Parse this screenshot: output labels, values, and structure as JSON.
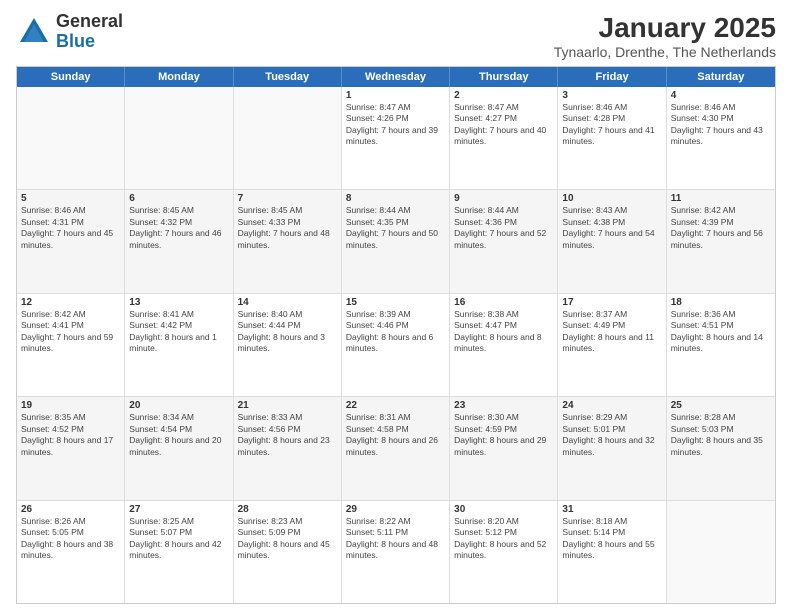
{
  "logo": {
    "general": "General",
    "blue": "Blue"
  },
  "header": {
    "month": "January 2025",
    "location": "Tynaarlo, Drenthe, The Netherlands"
  },
  "weekdays": [
    "Sunday",
    "Monday",
    "Tuesday",
    "Wednesday",
    "Thursday",
    "Friday",
    "Saturday"
  ],
  "rows": [
    [
      {
        "day": "",
        "empty": true
      },
      {
        "day": "",
        "empty": true
      },
      {
        "day": "",
        "empty": true
      },
      {
        "day": "1",
        "sunrise": "8:47 AM",
        "sunset": "4:26 PM",
        "daylight": "7 hours and 39 minutes."
      },
      {
        "day": "2",
        "sunrise": "8:47 AM",
        "sunset": "4:27 PM",
        "daylight": "7 hours and 40 minutes."
      },
      {
        "day": "3",
        "sunrise": "8:46 AM",
        "sunset": "4:28 PM",
        "daylight": "7 hours and 41 minutes."
      },
      {
        "day": "4",
        "sunrise": "8:46 AM",
        "sunset": "4:30 PM",
        "daylight": "7 hours and 43 minutes."
      }
    ],
    [
      {
        "day": "5",
        "sunrise": "8:46 AM",
        "sunset": "4:31 PM",
        "daylight": "7 hours and 45 minutes."
      },
      {
        "day": "6",
        "sunrise": "8:45 AM",
        "sunset": "4:32 PM",
        "daylight": "7 hours and 46 minutes."
      },
      {
        "day": "7",
        "sunrise": "8:45 AM",
        "sunset": "4:33 PM",
        "daylight": "7 hours and 48 minutes."
      },
      {
        "day": "8",
        "sunrise": "8:44 AM",
        "sunset": "4:35 PM",
        "daylight": "7 hours and 50 minutes."
      },
      {
        "day": "9",
        "sunrise": "8:44 AM",
        "sunset": "4:36 PM",
        "daylight": "7 hours and 52 minutes."
      },
      {
        "day": "10",
        "sunrise": "8:43 AM",
        "sunset": "4:38 PM",
        "daylight": "7 hours and 54 minutes."
      },
      {
        "day": "11",
        "sunrise": "8:42 AM",
        "sunset": "4:39 PM",
        "daylight": "7 hours and 56 minutes."
      }
    ],
    [
      {
        "day": "12",
        "sunrise": "8:42 AM",
        "sunset": "4:41 PM",
        "daylight": "7 hours and 59 minutes."
      },
      {
        "day": "13",
        "sunrise": "8:41 AM",
        "sunset": "4:42 PM",
        "daylight": "8 hours and 1 minute."
      },
      {
        "day": "14",
        "sunrise": "8:40 AM",
        "sunset": "4:44 PM",
        "daylight": "8 hours and 3 minutes."
      },
      {
        "day": "15",
        "sunrise": "8:39 AM",
        "sunset": "4:46 PM",
        "daylight": "8 hours and 6 minutes."
      },
      {
        "day": "16",
        "sunrise": "8:38 AM",
        "sunset": "4:47 PM",
        "daylight": "8 hours and 8 minutes."
      },
      {
        "day": "17",
        "sunrise": "8:37 AM",
        "sunset": "4:49 PM",
        "daylight": "8 hours and 11 minutes."
      },
      {
        "day": "18",
        "sunrise": "8:36 AM",
        "sunset": "4:51 PM",
        "daylight": "8 hours and 14 minutes."
      }
    ],
    [
      {
        "day": "19",
        "sunrise": "8:35 AM",
        "sunset": "4:52 PM",
        "daylight": "8 hours and 17 minutes."
      },
      {
        "day": "20",
        "sunrise": "8:34 AM",
        "sunset": "4:54 PM",
        "daylight": "8 hours and 20 minutes."
      },
      {
        "day": "21",
        "sunrise": "8:33 AM",
        "sunset": "4:56 PM",
        "daylight": "8 hours and 23 minutes."
      },
      {
        "day": "22",
        "sunrise": "8:31 AM",
        "sunset": "4:58 PM",
        "daylight": "8 hours and 26 minutes."
      },
      {
        "day": "23",
        "sunrise": "8:30 AM",
        "sunset": "4:59 PM",
        "daylight": "8 hours and 29 minutes."
      },
      {
        "day": "24",
        "sunrise": "8:29 AM",
        "sunset": "5:01 PM",
        "daylight": "8 hours and 32 minutes."
      },
      {
        "day": "25",
        "sunrise": "8:28 AM",
        "sunset": "5:03 PM",
        "daylight": "8 hours and 35 minutes."
      }
    ],
    [
      {
        "day": "26",
        "sunrise": "8:26 AM",
        "sunset": "5:05 PM",
        "daylight": "8 hours and 38 minutes."
      },
      {
        "day": "27",
        "sunrise": "8:25 AM",
        "sunset": "5:07 PM",
        "daylight": "8 hours and 42 minutes."
      },
      {
        "day": "28",
        "sunrise": "8:23 AM",
        "sunset": "5:09 PM",
        "daylight": "8 hours and 45 minutes."
      },
      {
        "day": "29",
        "sunrise": "8:22 AM",
        "sunset": "5:11 PM",
        "daylight": "8 hours and 48 minutes."
      },
      {
        "day": "30",
        "sunrise": "8:20 AM",
        "sunset": "5:12 PM",
        "daylight": "8 hours and 52 minutes."
      },
      {
        "day": "31",
        "sunrise": "8:18 AM",
        "sunset": "5:14 PM",
        "daylight": "8 hours and 55 minutes."
      },
      {
        "day": "",
        "empty": true
      }
    ]
  ]
}
